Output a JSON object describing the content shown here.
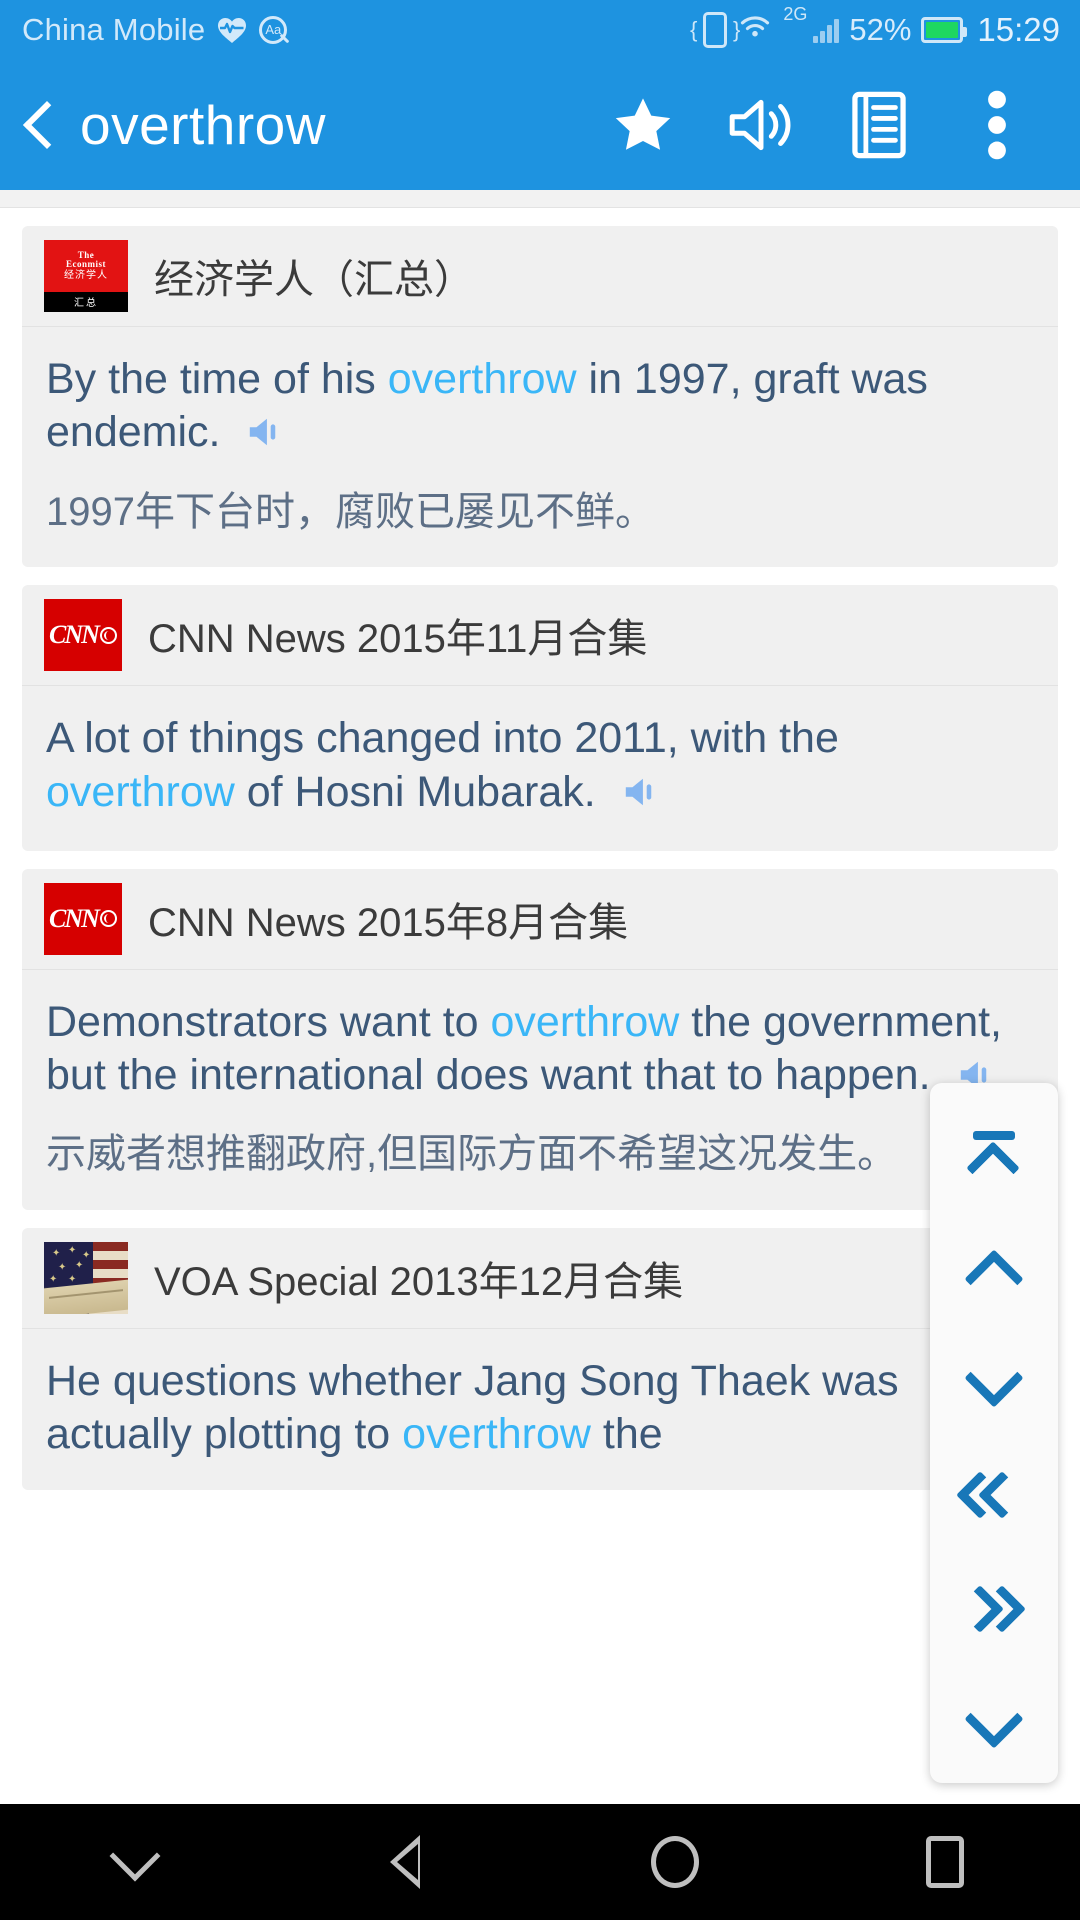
{
  "statusbar": {
    "carrier": "China Mobile",
    "heart_icon": "heart-pulse-icon",
    "aa_icon": "aa-search-icon",
    "vibrate_icon": "vibrate-icon",
    "wifi_icon": "wifi-icon",
    "network_type": "2G",
    "signal_icon": "signal-bars-icon",
    "battery_percent": "52%",
    "battery_icon": "battery-charging-icon",
    "clock": "15:29"
  },
  "toolbar": {
    "back_icon": "back-chevron-icon",
    "title": "overthrow",
    "star_icon": "star-filled-icon",
    "speaker_icon": "speaker-icon",
    "notes_icon": "notes-list-icon",
    "overflow_icon": "overflow-menu-icon"
  },
  "colors": {
    "brand_blue": "#1e93e0",
    "highlight_blue": "#3ab6f7",
    "sentence_text": "#3c5878",
    "translation_text": "#5d6f86",
    "nav_blue": "#1877b8",
    "card_bg": "#f0f0f0"
  },
  "cards": [
    {
      "source": "经济学人（汇总）",
      "logo": "economist-logo",
      "logo_lines": {
        "the": "The",
        "econ": "Econmist",
        "cn": "经济学人",
        "strip": "汇总"
      },
      "sentence_parts": [
        {
          "t": "By the time of his ",
          "hl": false
        },
        {
          "t": "overthrow",
          "hl": true
        },
        {
          "t": " in 1997, graft was endemic.",
          "hl": false
        }
      ],
      "translation": "1997年下台时，腐败已屡见不鲜。",
      "speaker_icon": "speaker-small-icon"
    },
    {
      "source": "CNN News 2015年11月合集",
      "logo": "cnn-logo",
      "logo_lines": {
        "text": "CNN"
      },
      "sentence_parts": [
        {
          "t": "A lot of things changed into 2011, with the ",
          "hl": false
        },
        {
          "t": "overthrow",
          "hl": true
        },
        {
          "t": " of Hosni Mubarak.",
          "hl": false
        }
      ],
      "translation": "",
      "speaker_icon": "speaker-small-icon"
    },
    {
      "source": "CNN News 2015年8月合集",
      "logo": "cnn-logo",
      "logo_lines": {
        "text": "CNN"
      },
      "sentence_parts": [
        {
          "t": "Demonstrators want to ",
          "hl": false
        },
        {
          "t": "overthrow",
          "hl": true
        },
        {
          "t": " the government, but the international does want that to happen.",
          "hl": false
        }
      ],
      "translation": "示威者想推翻政府,但国际方面不希望这况发生。",
      "speaker_icon": "speaker-small-icon"
    },
    {
      "source": "VOA Special 2013年12月合集",
      "logo": "voa-logo",
      "logo_lines": {
        "text": ""
      },
      "sentence_parts": [
        {
          "t": "He questions whether Jang Song Thaek was actually plotting to ",
          "hl": false
        },
        {
          "t": "overthrow",
          "hl": true
        },
        {
          "t": " the",
          "hl": false
        }
      ],
      "translation": "",
      "speaker_icon": "speaker-small-icon"
    }
  ],
  "floatnav": {
    "buttons": [
      {
        "name": "scroll-to-top-button",
        "icon": "top-chevron-icon"
      },
      {
        "name": "scroll-up-button",
        "icon": "chevron-up-icon"
      },
      {
        "name": "scroll-down-button",
        "icon": "chevron-down-icon"
      },
      {
        "name": "prev-page-button",
        "icon": "double-chevron-left-icon"
      },
      {
        "name": "next-page-button",
        "icon": "double-chevron-right-icon"
      },
      {
        "name": "scroll-to-bottom-button",
        "icon": "bottom-chevron-icon"
      }
    ]
  },
  "navbar": {
    "hide_icon": "hide-keyboard-icon",
    "back_icon": "android-back-icon",
    "home_icon": "android-home-icon",
    "recents_icon": "android-recents-icon"
  }
}
